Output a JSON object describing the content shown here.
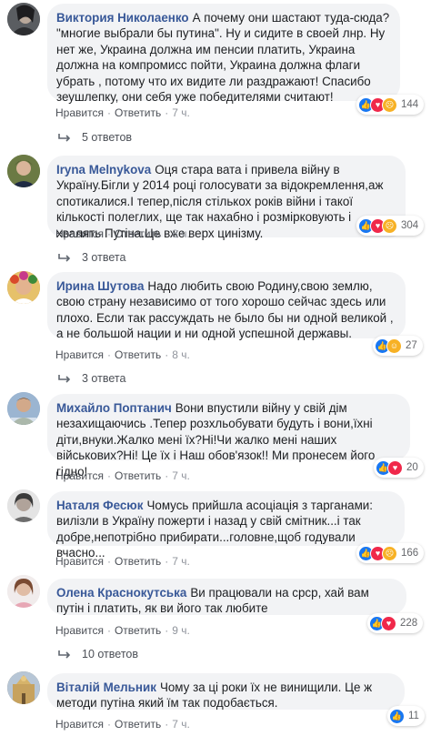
{
  "comments": [
    {
      "author": "Виктория Николаенко",
      "text": "А почему они шастают туда-сюда? \"многие выбрали бы путина\". Ну и сидите в своей лнр. Ну нет же, Украина должна им пенсии платить, Украина должна на компромисс пойти, Украина должна флаги убрать , потому что их видите ли раздражают! Спасибо зеушлепку, они себя уже победителями считают!",
      "reaction_count": "144",
      "like": "Нравится",
      "reply": "Ответить",
      "time": "7 ч.",
      "replies": "5 ответов"
    },
    {
      "author": "Iryna Melnykova",
      "text": "Оця стара вата і привела війну в Україну.Бігли у 2014 році голосувати за відокремлення,аж спотикалися.І тепер,після стількох років війни і такої кількості полеглих, ще так нахабно і розмірковують і хвалять Путіна.Це вже верх цинізму.",
      "reaction_count": "304",
      "like": "Нравится",
      "reply": "Ответить",
      "time": "8 ч.",
      "replies": "3 ответа"
    },
    {
      "author": "Ирина Шутова",
      "text": "Надо любить свою Родину,свою землю, свою страну независимо от того хорошо сейчас здесь или плохо. Если так рассуждать не было бы ни одной великой , а не большой нации и ни одной успешной державы.",
      "reaction_count": "27",
      "like": "Нравится",
      "reply": "Ответить",
      "time": "8 ч.",
      "replies": "3 ответа"
    },
    {
      "author": "Михайло Поптанич",
      "text": "Вони впустили війну у свій дім незахищаючись .Тепер розхльобувати будуть і вони,їхні діти,внуки.Жалко мені їх?Ні!Чи жалко мені наших військових?Ні! Це їх і Наш обов'язок!! Ми пронесем його гідно!",
      "reaction_count": "20",
      "like": "Нравится",
      "reply": "Ответить",
      "time": "7 ч."
    },
    {
      "author": "Наталя Фесюк",
      "text": "Чомусь прийшла асоціація з тарганами: вилізли в Україну пожерти і назад у свій смітник...і так добре,непотрібно прибирати...головне,щоб годували вчасно...",
      "reaction_count": "166",
      "like": "Нравится",
      "reply": "Ответить",
      "time": "7 ч."
    },
    {
      "author": "Олена Краснокутська",
      "text": "Ви працювали на срср, хай вам путін і платить, як ви його так любите",
      "reaction_count": "228",
      "like": "Нравится",
      "reply": "Ответить",
      "time": "9 ч.",
      "replies": "10 ответов"
    },
    {
      "author": "Віталій Мельник",
      "text": "Чому за ці роки їх не винищили. Це ж методи путіна який їм так подобається.",
      "reaction_count": "11",
      "like": "Нравится",
      "reply": "Ответить",
      "time": "7 ч."
    }
  ],
  "colors": {
    "author": "#385898",
    "bubble": "#f2f3f5",
    "like": "#1877f2",
    "love": "#f0284a",
    "haha": "#f7b125"
  }
}
